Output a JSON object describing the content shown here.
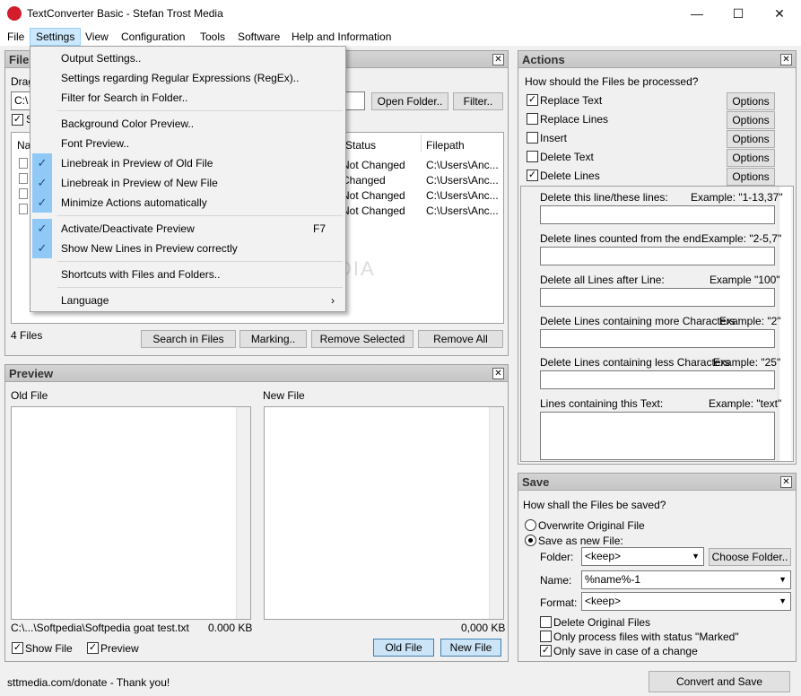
{
  "window": {
    "title": "TextConverter Basic - Stefan Trost Media",
    "min": "—",
    "max": "☐",
    "close": "✕"
  },
  "menubar": [
    "File",
    "Settings",
    "View",
    "Configuration",
    "Tools",
    "Software",
    "Help and Information"
  ],
  "settings_menu": {
    "items": [
      {
        "label": "Output Settings..",
        "checked": false
      },
      {
        "label": "Settings regarding Regular Expressions (RegEx)..",
        "checked": false
      },
      {
        "label": "Filter for Search in Folder..",
        "checked": false
      },
      {
        "label": "Background Color Preview..",
        "checked": false
      },
      {
        "label": "Font Preview..",
        "checked": false
      },
      {
        "label": "Linebreak in Preview of Old File",
        "checked": true
      },
      {
        "label": "Linebreak in Preview of New File",
        "checked": true
      },
      {
        "label": "Minimize Actions automatically",
        "checked": true
      },
      {
        "label": "Activate/Deactivate Preview",
        "checked": true,
        "shortcut": "F7"
      },
      {
        "label": "Show New Lines in Preview correctly",
        "checked": true
      },
      {
        "label": "Shortcuts with Files and Folders..",
        "checked": false
      },
      {
        "label": "Language",
        "checked": false,
        "submenu": "›"
      }
    ]
  },
  "files": {
    "title": "Files",
    "drag_label": "Drag",
    "path_value": "C:\\",
    "open_folder": "Open Folder..",
    "filter": "Filter..",
    "subfolders_label": "S",
    "columns": [
      "Na",
      "Status",
      "Filepath"
    ],
    "rows": [
      {
        "status": "Not Changed",
        "path": "C:\\Users\\Anc..."
      },
      {
        "status": "Changed",
        "path": "C:\\Users\\Anc..."
      },
      {
        "status": "Not Changed",
        "path": "C:\\Users\\Anc..."
      },
      {
        "status": "Not Changed",
        "path": "C:\\Users\\Anc..."
      }
    ],
    "count": "4 Files",
    "buttons": [
      "Search in Files",
      "Marking..",
      "Remove Selected",
      "Remove All"
    ]
  },
  "preview": {
    "title": "Preview",
    "old_label": "Old File",
    "new_label": "New File",
    "old_path": "C:\\...\\Softpedia\\Softpedia goat test.txt",
    "old_size": "0.000 KB",
    "new_size": "0,000 KB",
    "show_file": "Show File",
    "preview_cb": "Preview",
    "old_btn": "Old File",
    "new_btn": "New File"
  },
  "actions": {
    "title": "Actions",
    "question": "How should the Files be processed?",
    "options_label": "Options",
    "items": [
      {
        "label": "Replace Text",
        "checked": true
      },
      {
        "label": "Replace Lines",
        "checked": false
      },
      {
        "label": "Insert",
        "checked": false
      },
      {
        "label": "Delete Text",
        "checked": false
      },
      {
        "label": "Delete Lines",
        "checked": true
      }
    ],
    "fields": [
      {
        "label": "Delete this line/these lines:",
        "example": "Example: \"1-13,37\""
      },
      {
        "label": "Delete lines counted from the end:",
        "example": "Example: \"2-5,7\""
      },
      {
        "label": "Delete all Lines after Line:",
        "example": "Example \"100\""
      },
      {
        "label": "Delete Lines containing more Characters than:",
        "example": "Example: \"2\""
      },
      {
        "label": "Delete Lines containing less Characters than:",
        "example": "Example: \"25\""
      },
      {
        "label": "Lines containing this Text:",
        "example": "Example: \"text\""
      }
    ]
  },
  "save": {
    "title": "Save",
    "question": "How shall the Files be saved?",
    "overwrite": "Overwrite Original File",
    "save_new": "Save as new File:",
    "folder_label": "Folder:",
    "folder_value": "<keep>",
    "choose_folder": "Choose Folder..",
    "name_label": "Name:",
    "name_value": "%name%-1",
    "format_label": "Format:",
    "format_value": "<keep>",
    "delete_original": "Delete Original Files",
    "only_marked": "Only process files with status \"Marked\"",
    "only_change": "Only save in case of a change",
    "only_change_checked": true
  },
  "status": {
    "text": "sttmedia.com/donate - Thank you!",
    "convert": "Convert and Save"
  },
  "watermark": "SOFTPEDIA"
}
